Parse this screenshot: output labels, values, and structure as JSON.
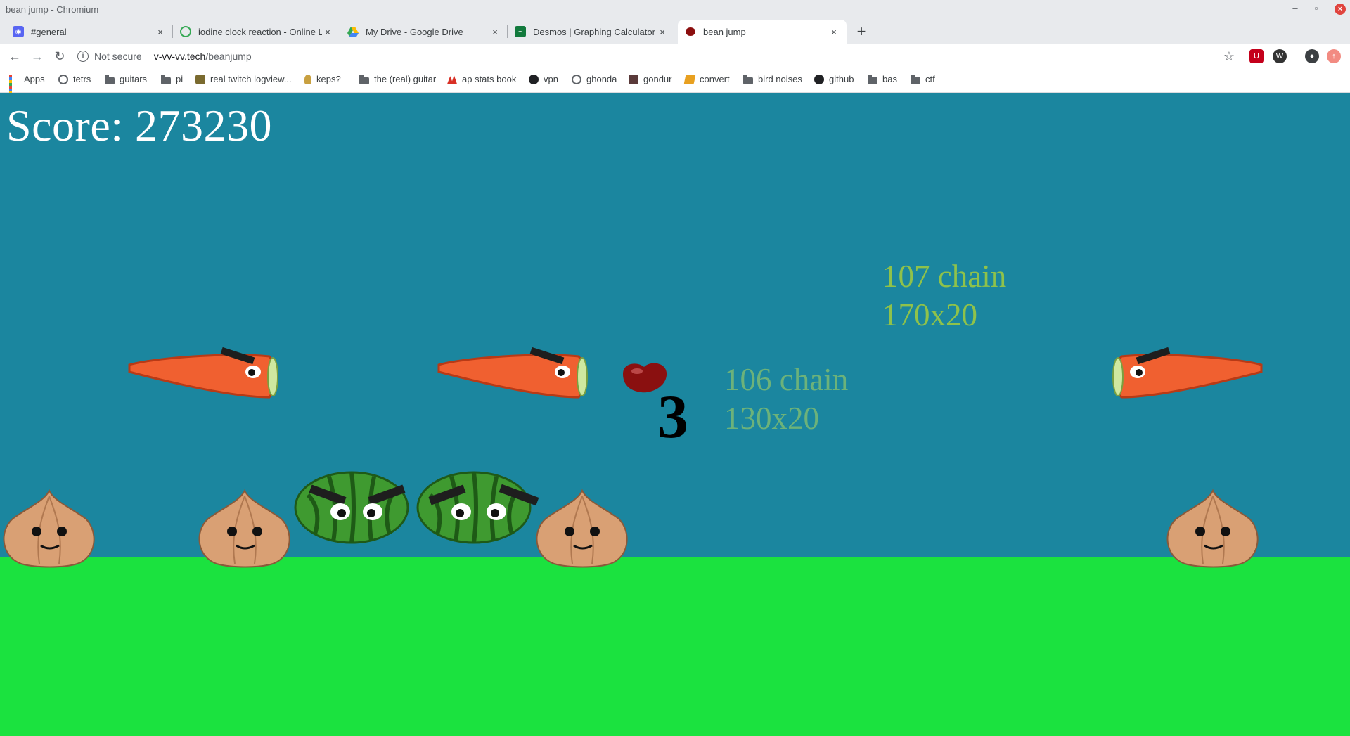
{
  "window": {
    "title": "bean jump - Chromium",
    "minimize": "–",
    "restore": "▫",
    "close": "×"
  },
  "tabs": [
    {
      "label": "#general",
      "icon": "discord-icon",
      "color": "#5865f2",
      "close": "×"
    },
    {
      "label": "iodine clock reaction - Online L",
      "icon": "flask-icon",
      "color": "#34a853",
      "close": "×"
    },
    {
      "label": "My Drive - Google Drive",
      "icon": "google-drive-icon",
      "color": "#fbbc04",
      "close": "×"
    },
    {
      "label": "Desmos | Graphing Calculator",
      "icon": "desmos-icon",
      "color": "#127a3d",
      "close": "×"
    },
    {
      "label": "bean jump",
      "icon": "bean-icon",
      "color": "#8b0e0e",
      "close": "×",
      "active": true
    }
  ],
  "newtab": "+",
  "toolbar": {
    "back": "←",
    "forward": "→",
    "reload": "↻",
    "security": "Not secure",
    "url_host": "v-vv-vv.tech",
    "url_path": "/beanjump",
    "star": "☆",
    "info": "i"
  },
  "extensions": [
    {
      "icon": "ublock-icon",
      "color": "#c4001b",
      "glyph": "U"
    },
    {
      "icon": "w-extension-icon",
      "color": "#333333",
      "glyph": "W"
    },
    {
      "icon": "profile-avatar-icon",
      "color": "#3c4043",
      "glyph": "●"
    },
    {
      "icon": "update-icon",
      "color": "#f28b82",
      "glyph": "↑"
    }
  ],
  "bookmarks": [
    {
      "label": "Apps",
      "icon": "apps-grid-icon"
    },
    {
      "label": "tetrs",
      "icon": "globe-icon"
    },
    {
      "label": "guitars",
      "icon": "folder-icon"
    },
    {
      "label": "pi",
      "icon": "folder-icon"
    },
    {
      "label": "real twitch logview...",
      "icon": "twitch-log-icon"
    },
    {
      "label": "keps?",
      "icon": "person-icon"
    },
    {
      "label": "the (real) guitar",
      "icon": "folder-icon"
    },
    {
      "label": "ap stats book",
      "icon": "stats-book-icon"
    },
    {
      "label": "vpn",
      "icon": "github-icon"
    },
    {
      "label": "ghonda",
      "icon": "globe-icon"
    },
    {
      "label": "gondur",
      "icon": "gondur-icon"
    },
    {
      "label": "convert",
      "icon": "convert-icon"
    },
    {
      "label": "bird noises",
      "icon": "folder-icon"
    },
    {
      "label": "github",
      "icon": "github-icon"
    },
    {
      "label": "bas",
      "icon": "folder-icon"
    },
    {
      "label": "ctf",
      "icon": "folder-icon"
    }
  ],
  "game": {
    "score_text": "Score: 273230",
    "countdown": "3",
    "chains": [
      {
        "line1": "107 chain",
        "line2": "170x20",
        "color": "#8fc24a"
      },
      {
        "line1": "106 chain",
        "line2": "130x20",
        "color": "#6cb27a"
      }
    ],
    "colors": {
      "sky": "#1b869f",
      "ground": "#1be23f"
    },
    "sprites": {
      "player": "bean",
      "carrots": 3,
      "onions": 4,
      "watermelons": 2
    }
  }
}
